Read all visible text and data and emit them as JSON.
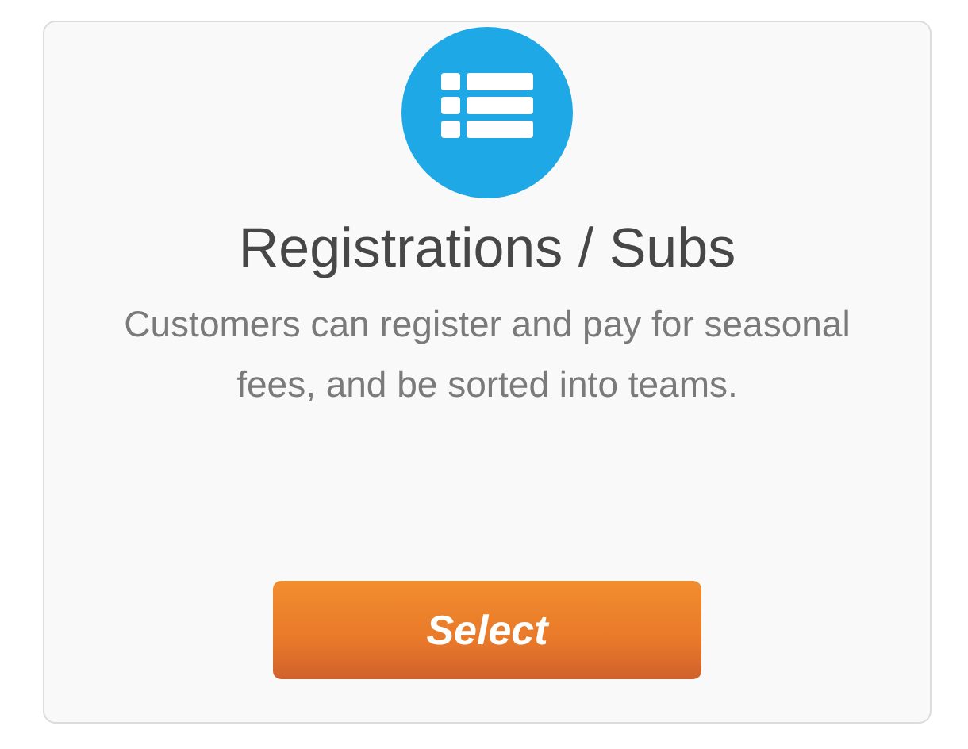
{
  "card": {
    "title": "Registrations / Subs",
    "description": "Customers can register and pay for seasonal fees, and be sorted into teams.",
    "button": "Select"
  }
}
